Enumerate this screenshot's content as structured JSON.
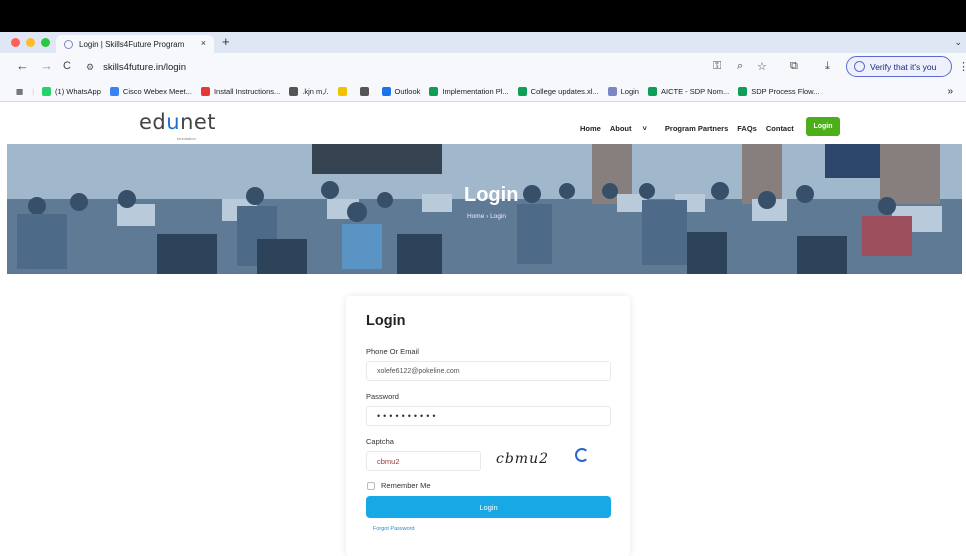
{
  "browser": {
    "tab_title": "Login | Skills4Future Program",
    "tab_close": "×",
    "new_tab": "+",
    "url": "skills4future.in/login",
    "verify_label": "Verify that it's you",
    "nav": {
      "back": "←",
      "forward": "→",
      "reload": "C"
    },
    "bookmarks": [
      {
        "label": "(1) WhatsApp",
        "icon": "whatsapp-icon",
        "color": "#25d366"
      },
      {
        "label": "Cisco Webex Meet...",
        "icon": "webex-icon",
        "color": "#3b82f6"
      },
      {
        "label": "Install Instructions...",
        "icon": "doc-icon",
        "color": "#e53935"
      },
      {
        "label": ".kjn m,/.",
        "icon": "folder-icon",
        "color": "#555555"
      },
      {
        "label": "",
        "icon": "sheet-icon",
        "color": "#f2c200"
      },
      {
        "label": "",
        "icon": "download-icon",
        "color": "#555555"
      },
      {
        "label": "Outlook",
        "icon": "outlook-icon",
        "color": "#1a73e8"
      },
      {
        "label": "Implementation Pl...",
        "icon": "sheet-icon",
        "color": "#0f9d58"
      },
      {
        "label": "College updates.xl...",
        "icon": "sheet-icon",
        "color": "#0f9d58"
      },
      {
        "label": "Login",
        "icon": "globe-icon",
        "color": "#7b86c4"
      },
      {
        "label": "AICTE - SDP  Nom...",
        "icon": "sheet-icon",
        "color": "#0f9d58"
      },
      {
        "label": "SDP Process Flow...",
        "icon": "sheet-icon",
        "color": "#0f9d58"
      }
    ],
    "more_bookmarks": "»"
  },
  "site": {
    "logo_pre": "ed",
    "logo_u": "u",
    "logo_post": "net",
    "logo_sub": "foundation",
    "nav": [
      "Home",
      "About",
      "Program Partners",
      "FAQs",
      "Contact"
    ],
    "nav_login": "Login",
    "hero_title": "Login",
    "hero_crumb": "Home  ›  Login"
  },
  "form": {
    "title": "Login",
    "phone_label": "Phone Or Email",
    "phone_value": "xolefe6122@pokeline.com",
    "password_label": "Password",
    "password_value": "••••••••••",
    "captcha_label": "Captcha",
    "captcha_value": "cbmu2",
    "captcha_image_text": "cbmu2",
    "remember_label": "Remember Me",
    "submit_label": "Login",
    "forgot_label": "Forgot Password"
  },
  "colors": {
    "brand_green": "#4caf1a",
    "button_blue": "#17a8e6",
    "logo_blue": "#1a73c8"
  }
}
